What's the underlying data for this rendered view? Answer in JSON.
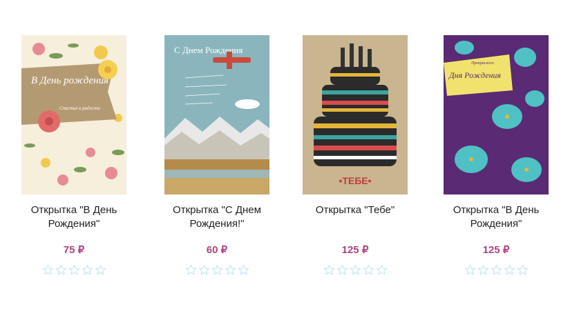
{
  "products": [
    {
      "title": "Открытка \"В День Рождения\"",
      "price": "75 ₽",
      "image_text": "В День рождения",
      "image_text_small": "Счастья и радости",
      "rating": 0,
      "max_rating": 5
    },
    {
      "title": "Открытка \"С Днем Рождения!\"",
      "price": "60 ₽",
      "image_text": "С Днем Рождения",
      "rating": 0,
      "max_rating": 5
    },
    {
      "title": "Открытка \"Тебе\"",
      "price": "125 ₽",
      "image_text": "•ТЕБЕ•",
      "rating": 0,
      "max_rating": 5
    },
    {
      "title": "Открытка \"В День Рождения\"",
      "price": "125 ₽",
      "image_text_top": "Прекрасного",
      "image_text": "Дня Рождения",
      "rating": 0,
      "max_rating": 5
    }
  ],
  "colors": {
    "price": "#b0437f",
    "star_outline": "#bfe3ef"
  },
  "icons": {
    "rating": "star-outline-icon"
  }
}
